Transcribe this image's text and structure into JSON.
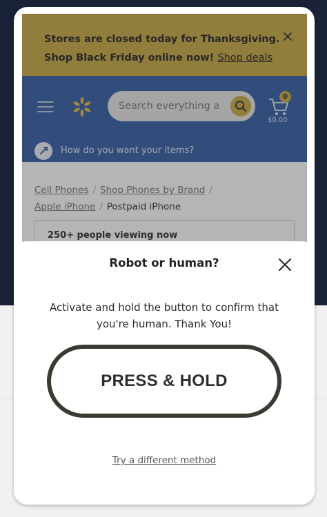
{
  "promo": {
    "line1": "Stores are closed today for Thanksgiving.",
    "line2_text": "Shop Black Friday online now!",
    "link": "Shop deals",
    "bg_color": "#c6a63e"
  },
  "header": {
    "bg_color": "#2d56a4",
    "menu_icon": "hamburger-menu-icon",
    "logo_icon": "spark-logo-icon",
    "search_placeholder": "Search everything a",
    "cart_count": "0",
    "cart_total": "$0.00",
    "fulfillment_prompt": "How do you want your items?"
  },
  "breadcrumb": {
    "items": [
      "Cell Phones",
      "Shop Phones by Brand",
      "Apple iPhone"
    ],
    "current": "Postpaid iPhone"
  },
  "viewers_notice": "250+ people viewing now",
  "modal": {
    "title": "Robot or human?",
    "instructions_line1": "Activate and hold the button to confirm that",
    "instructions_line2": "you're human. Thank You!",
    "button_label": "PRESS & HOLD",
    "alt_link": "Try a different method"
  }
}
